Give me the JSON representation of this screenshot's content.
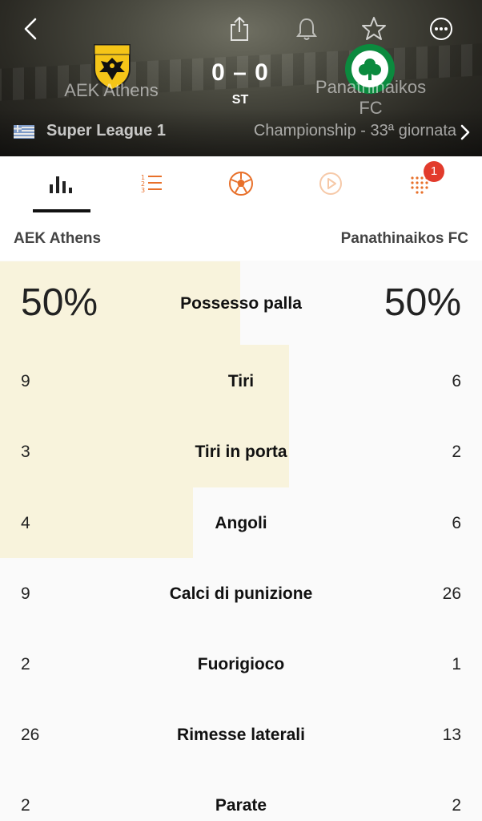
{
  "match": {
    "home_team": "AEK Athens",
    "away_team_line1": "Panathinaikos",
    "away_team_line2": "FC",
    "score": "0 – 0",
    "status": "ST",
    "league": "Super League 1",
    "round": "Championship - 33ª giornata"
  },
  "tabs": {
    "badge_count": "1"
  },
  "teams_row": {
    "home": "AEK Athens",
    "away": "Panathinaikos FC"
  },
  "stats": [
    {
      "label": "Possesso palla",
      "home": "50%",
      "away": "50%"
    },
    {
      "label": "Tiri",
      "home": "9",
      "away": "6"
    },
    {
      "label": "Tiri in porta",
      "home": "3",
      "away": "2"
    },
    {
      "label": "Angoli",
      "home": "4",
      "away": "6"
    },
    {
      "label": "Calci di punizione",
      "home": "9",
      "away": "26"
    },
    {
      "label": "Fuorigioco",
      "home": "2",
      "away": "1"
    },
    {
      "label": "Rimesse laterali",
      "home": "26",
      "away": "13"
    },
    {
      "label": "Parate",
      "home": "2",
      "away": "2"
    }
  ],
  "colors": {
    "accent": "#e8702a",
    "highlight": "#f8f3dc",
    "badge": "#e23b2c",
    "aek_yellow": "#f5c518",
    "pao_green": "#0b8a3e"
  },
  "icons": {
    "back": "back-chevron-icon",
    "share": "share-icon",
    "notify": "bell-icon",
    "favorite": "star-icon",
    "more": "more-icon",
    "flag": "greece-flag-icon",
    "round_next": "chevron-right-icon",
    "tab_stats": "bar-chart-icon",
    "tab_table": "ranking-list-icon",
    "tab_lineups": "football-icon",
    "tab_video": "play-icon",
    "tab_heatmap": "dots-grid-icon"
  }
}
